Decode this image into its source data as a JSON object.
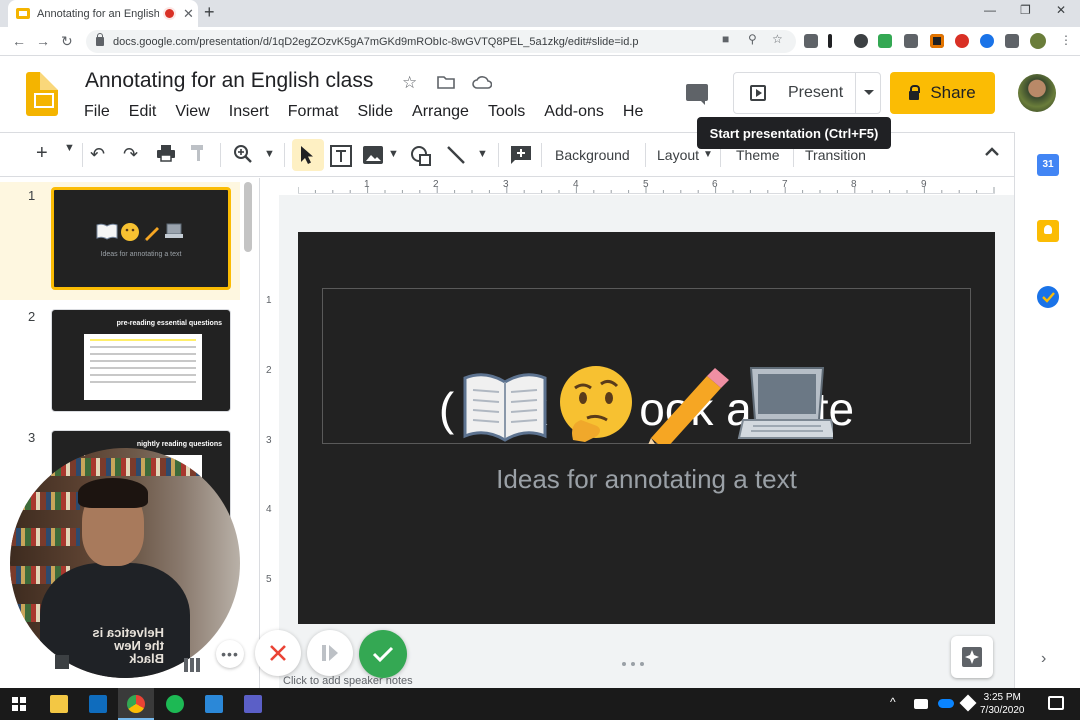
{
  "browser": {
    "tab_title": "Annotating for an English cla",
    "url": "docs.google.com/presentation/d/1qD2egZOzvK5gA7mGKd9mRObIc-8wGVTQ8PEL_5a1zkg/edit#slide=id.p"
  },
  "document": {
    "title": "Annotating for an English class"
  },
  "menu": [
    "File",
    "Edit",
    "View",
    "Insert",
    "Format",
    "Slide",
    "Arrange",
    "Tools",
    "Add-ons",
    "He"
  ],
  "header": {
    "present_label": "Present",
    "share_label": "Share",
    "tooltip": "Start presentation (Ctrl+F5)"
  },
  "toolbar": {
    "background_label": "Background",
    "layout_label": "Layout",
    "theme_label": "Theme",
    "transition_label": "Transition"
  },
  "ruler": {
    "h_ticks": [
      "1",
      "2",
      "3",
      "4",
      "5",
      "6",
      "7",
      "8",
      "9"
    ],
    "v_ticks": [
      "1",
      "2",
      "3",
      "4",
      "5"
    ]
  },
  "slides": [
    {
      "number": "1",
      "title": "",
      "subtitle": "Ideas for annotating a text"
    },
    {
      "number": "2",
      "title": "pre-reading essential questions"
    },
    {
      "number": "3",
      "title": "nightly reading questions"
    }
  ],
  "current_slide": {
    "title": "ook and te",
    "title_prefix": "( k",
    "subtitle": "Ideas for annotating a text",
    "emojis": [
      "open-book",
      "thinking-face",
      "pencil",
      "laptop"
    ]
  },
  "webcam": {
    "shirt_text": "Helvetica is the New Black"
  },
  "notes": {
    "placeholder": "Click to add speaker notes"
  },
  "taskbar": {
    "time": "3:25 PM",
    "date": "7/30/2020"
  },
  "colors": {
    "share_yellow": "#fbbc04",
    "selected_slide_border": "#fbbc04",
    "slide_bg": "#222222",
    "check_green": "#34a853",
    "cancel_red": "#ea4335"
  }
}
